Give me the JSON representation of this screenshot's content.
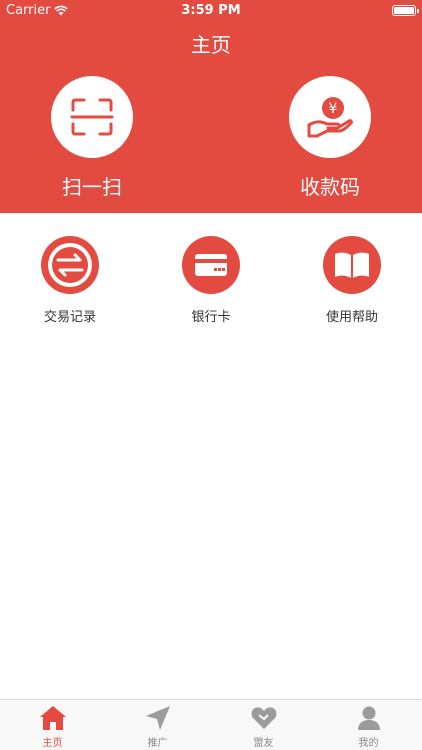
{
  "status_bar": {
    "carrier": "Carrier",
    "time": "3:59 PM"
  },
  "header": {
    "title": "主页",
    "background_color": "#e34b40"
  },
  "quick_actions": [
    {
      "label": "扫一扫",
      "icon": "scan-icon"
    },
    {
      "label": "收款码",
      "icon": "receive-payment-icon"
    }
  ],
  "features": [
    {
      "label": "交易记录",
      "icon": "transfer-arrows-icon"
    },
    {
      "label": "银行卡",
      "icon": "bank-card-icon"
    },
    {
      "label": "使用帮助",
      "icon": "book-icon"
    }
  ],
  "tab_bar": {
    "active_index": 0,
    "active_color": "#e34b40",
    "inactive_color": "#9b9b9b",
    "tabs": [
      {
        "label": "主页",
        "icon": "home-icon"
      },
      {
        "label": "推广",
        "icon": "paper-plane-icon"
      },
      {
        "label": "盟友",
        "icon": "heart-icon"
      },
      {
        "label": "我的",
        "icon": "user-icon"
      }
    ]
  }
}
